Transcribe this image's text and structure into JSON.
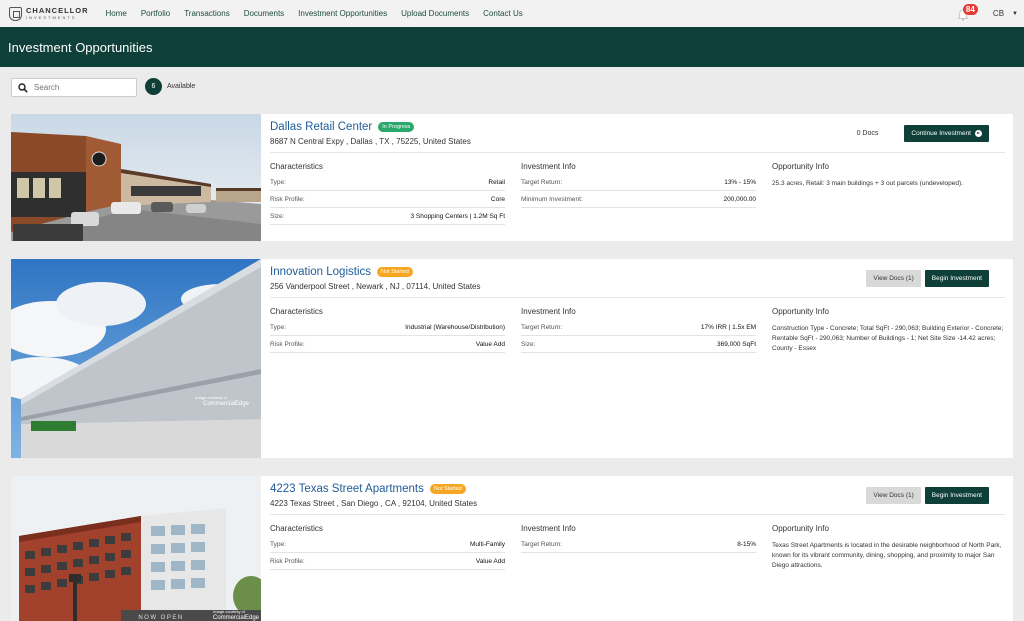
{
  "brand": {
    "name": "CHANCELLOR",
    "sub": "INVESTMENTS"
  },
  "nav": {
    "links": [
      "Home",
      "Portfolio",
      "Transactions",
      "Documents",
      "Investment Opportunities",
      "Upload Documents",
      "Contact Us"
    ]
  },
  "notifications": {
    "count": "84"
  },
  "user": {
    "initials": "CB"
  },
  "page": {
    "title": "Investment Opportunities"
  },
  "search": {
    "placeholder": "Search",
    "value": ""
  },
  "available": {
    "count": "6",
    "label": "Available"
  },
  "labels": {
    "characteristics": "Characteristics",
    "investment_info": "Investment Info",
    "opportunity_info": "Opportunity Info"
  },
  "colors": {
    "brand": "#0e3f38",
    "in_progress": "#2aa76a",
    "not_started": "#f5a623",
    "title_link": "#1f5c98",
    "notification": "#e53935"
  },
  "cards": [
    {
      "title": "Dallas Retail Center",
      "status": "In Progress",
      "address": "8687 N Central Expy , Dallas , TX , 75225, United States",
      "docs": "0 Docs",
      "primary_button": "Continue Investment",
      "characteristics": [
        {
          "k": "Type:",
          "v": "Retail"
        },
        {
          "k": "Risk Profile:",
          "v": "Core"
        },
        {
          "k": "Size:",
          "v": "3 Shopping Centers | 1.2M Sq Ft"
        }
      ],
      "investment": [
        {
          "k": "Target Return:",
          "v": "13% - 15%"
        },
        {
          "k": "Minimum Investment:",
          "v": "200,000.00"
        }
      ],
      "opportunity": "25.3 acres, Retail: 3 main buildings + 3 out parcels (undeveloped)."
    },
    {
      "title": "Innovation Logistics",
      "status": "Not Started",
      "address": "256 Vanderpool Street , Newark , NJ , 07114, United States",
      "secondary_button": "View Docs (1)",
      "primary_button": "Begin Investment",
      "characteristics": [
        {
          "k": "Type:",
          "v": "Industrial (Warehouse/Distribution)"
        },
        {
          "k": "Risk Profile:",
          "v": "Value Add"
        }
      ],
      "investment": [
        {
          "k": "Target Return:",
          "v": "17% IRR | 1.5x EM"
        },
        {
          "k": "Size:",
          "v": "369,000 SqFt"
        }
      ],
      "opportunity": "Construction Type - Concrete; Total SqFt - 290,063; Building Exterior - Concrete; Rentable SqFt - 290,063; Number of Buildings - 1; Net Site Size -14.42 acres; County - Essex",
      "image_credit_small": "Image courtesy of",
      "image_credit": "CommercialEdge"
    },
    {
      "title": "4223 Texas Street Apartments",
      "status": "Not Started",
      "address": "4223 Texas Street , San Diego , CA , 92104, United States",
      "secondary_button": "View Docs (1)",
      "primary_button": "Begin Investment",
      "characteristics": [
        {
          "k": "Type:",
          "v": "Multi-Family"
        },
        {
          "k": "Risk Profile:",
          "v": "Value Add"
        }
      ],
      "investment": [
        {
          "k": "Target Return:",
          "v": "8-15%"
        }
      ],
      "opportunity": "Texas Street Apartments is located in the desirable neighborhood of North Park, known for its vibrant community, dining, shopping, and proximity to major San Diego attractions.",
      "image_sign": "NOW OPEN",
      "image_credit_small": "Image courtesy of",
      "image_credit": "CommercialEdge"
    }
  ]
}
